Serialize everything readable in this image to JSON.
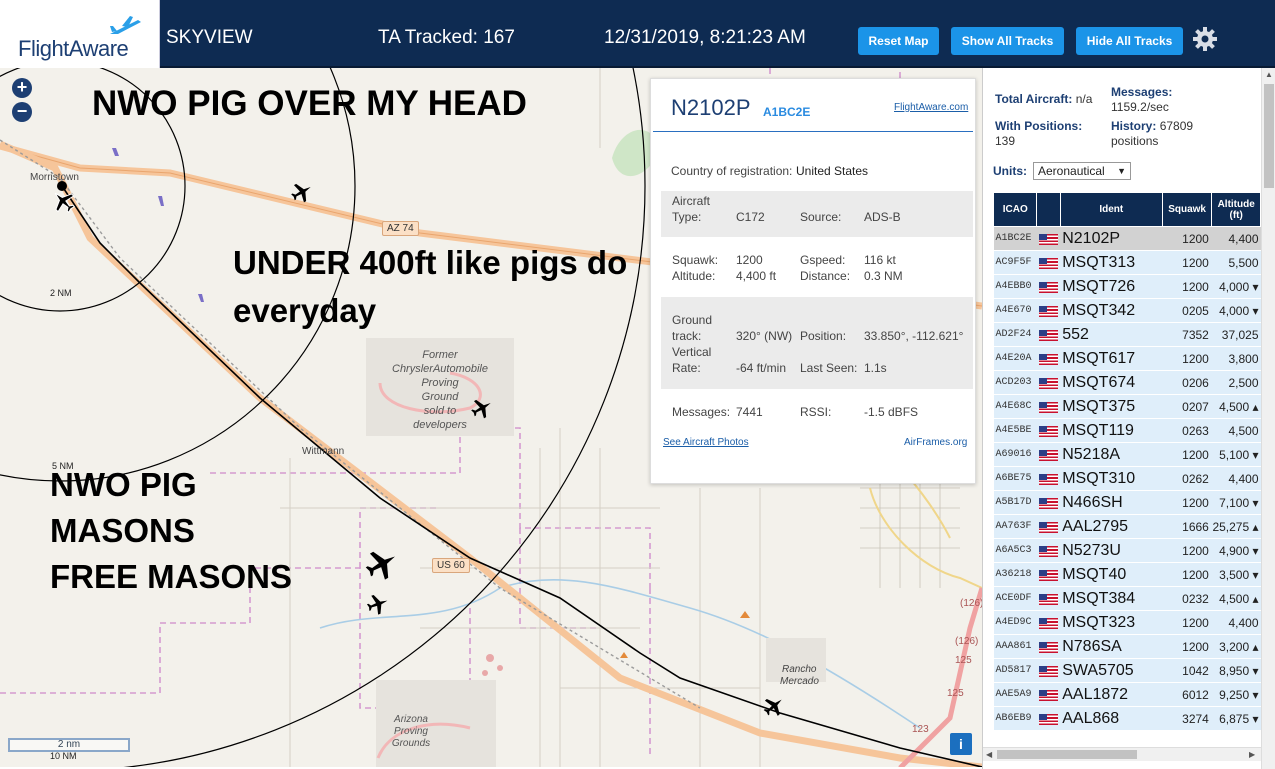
{
  "header": {
    "logo_text": "FlightAware",
    "app_name": "SKYVIEW",
    "tracked": "TA Tracked: 167",
    "datetime": "12/31/2019, 8:21:23 AM",
    "buttons": [
      "Reset Map",
      "Show All Tracks",
      "Hide All Tracks"
    ],
    "settings_icon": "gear-icon"
  },
  "map": {
    "annotations": [
      "NWO PIG OVER MY HEAD",
      "UNDER 400ft like pigs do",
      "everyday",
      "NWO PIG",
      "MASONS",
      "FREE MASONS"
    ],
    "places": [
      "Morristown",
      "Wittmann",
      "Rancho",
      "Mercado"
    ],
    "poi_former": [
      "Former",
      "ChryslerAutomobile",
      "Proving",
      "Ground",
      "sold to",
      "developers"
    ],
    "poi_arizona": [
      "Arizona",
      "Proving",
      "Grounds"
    ],
    "roads": [
      "AZ 74",
      "US 60"
    ],
    "ring_labels": [
      "2 NM",
      "5 NM",
      "10 NM"
    ],
    "route_numbers": [
      "(126)",
      "(126)",
      "125",
      "125",
      "123"
    ],
    "scale": "2 nm",
    "zoom_in": "+",
    "zoom_out": "−",
    "info": "i"
  },
  "detail": {
    "callsign": "N2102P",
    "icao": "A1BC2E",
    "link": "FlightAware.com",
    "country_label": "Country of registration:",
    "country": "United States",
    "aircraft_type_label1": "Aircraft",
    "aircraft_type_label2": "Type:",
    "aircraft_type": "C172",
    "source_label": "Source:",
    "source": "ADS-B",
    "squawk_label": "Squawk:",
    "squawk": "1200",
    "gspeed_label": "Gspeed:",
    "gspeed": "116 kt",
    "altitude_label": "Altitude:",
    "altitude": "4,400 ft",
    "distance_label": "Distance:",
    "distance": "0.3 NM",
    "track_label1": "Ground",
    "track_label2": "track:",
    "track": "320° (NW)",
    "position_label": "Position:",
    "position": "33.850°, -112.621°",
    "vrate_label1": "Vertical",
    "vrate_label2": "Rate:",
    "vrate": "-64 ft/min",
    "lastseen_label": "Last Seen:",
    "lastseen": "1.1s",
    "messages_label": "Messages:",
    "messages": "7441",
    "rssi_label": "RSSI:",
    "rssi": "-1.5 dBFS",
    "photos": "See Aircraft Photos",
    "airframes": "AirFrames.org"
  },
  "stats": {
    "total_label": "Total Aircraft:",
    "total": "n/a",
    "messages_label": "Messages:",
    "messages": "1159.2/sec",
    "withpos_label": "With Positions:",
    "withpos": "139",
    "history_label": "History:",
    "history": "67809",
    "history_unit": "positions",
    "units_label": "Units:",
    "units": "Aeronautical"
  },
  "table": {
    "headers": [
      "ICAO",
      "",
      "Ident",
      "Squawk",
      "Altitude (ft)"
    ],
    "rows": [
      {
        "icao": "A1BC2E",
        "ident": "N2102P",
        "squawk": "1200",
        "alt": "4,400"
      },
      {
        "icao": "AC9F5F",
        "ident": "MSQT313",
        "squawk": "1200",
        "alt": "5,500"
      },
      {
        "icao": "A4EBB0",
        "ident": "MSQT726",
        "squawk": "1200",
        "alt": "4,000 ▾"
      },
      {
        "icao": "A4E670",
        "ident": "MSQT342",
        "squawk": "0205",
        "alt": "4,000 ▾"
      },
      {
        "icao": "AD2F24",
        "ident": "552",
        "squawk": "7352",
        "alt": "37,025"
      },
      {
        "icao": "A4E20A",
        "ident": "MSQT617",
        "squawk": "1200",
        "alt": "3,800"
      },
      {
        "icao": "ACD203",
        "ident": "MSQT674",
        "squawk": "0206",
        "alt": "2,500"
      },
      {
        "icao": "A4E68C",
        "ident": "MSQT375",
        "squawk": "0207",
        "alt": "4,500 ▴"
      },
      {
        "icao": "A4E5BE",
        "ident": "MSQT119",
        "squawk": "0263",
        "alt": "4,500"
      },
      {
        "icao": "A69016",
        "ident": "N5218A",
        "squawk": "1200",
        "alt": "5,100 ▾"
      },
      {
        "icao": "A6BE75",
        "ident": "MSQT310",
        "squawk": "0262",
        "alt": "4,400"
      },
      {
        "icao": "A5B17D",
        "ident": "N466SH",
        "squawk": "1200",
        "alt": "7,100 ▾"
      },
      {
        "icao": "AA763F",
        "ident": "AAL2795",
        "squawk": "1666",
        "alt": "25,275 ▴"
      },
      {
        "icao": "A6A5C3",
        "ident": "N5273U",
        "squawk": "1200",
        "alt": "4,900 ▾"
      },
      {
        "icao": "A36218",
        "ident": "MSQT40",
        "squawk": "1200",
        "alt": "3,500 ▾"
      },
      {
        "icao": "ACE0DF",
        "ident": "MSQT384",
        "squawk": "0232",
        "alt": "4,500 ▴"
      },
      {
        "icao": "A4ED9C",
        "ident": "MSQT323",
        "squawk": "1200",
        "alt": "4,400"
      },
      {
        "icao": "AAA861",
        "ident": "N786SA",
        "squawk": "1200",
        "alt": "3,200 ▴"
      },
      {
        "icao": "AD5817",
        "ident": "SWA5705",
        "squawk": "1042",
        "alt": "8,950 ▾"
      },
      {
        "icao": "AAE5A9",
        "ident": "AAL1872",
        "squawk": "6012",
        "alt": "9,250 ▾"
      },
      {
        "icao": "AB6EB9",
        "ident": "AAL868",
        "squawk": "3274",
        "alt": "6,875 ▾"
      }
    ]
  },
  "colors": {
    "header_bg": "#0e2b52",
    "button_bg": "#1b94e8",
    "row_bg": "#dfeefa",
    "selected_row_bg": "#d2d2d2"
  }
}
